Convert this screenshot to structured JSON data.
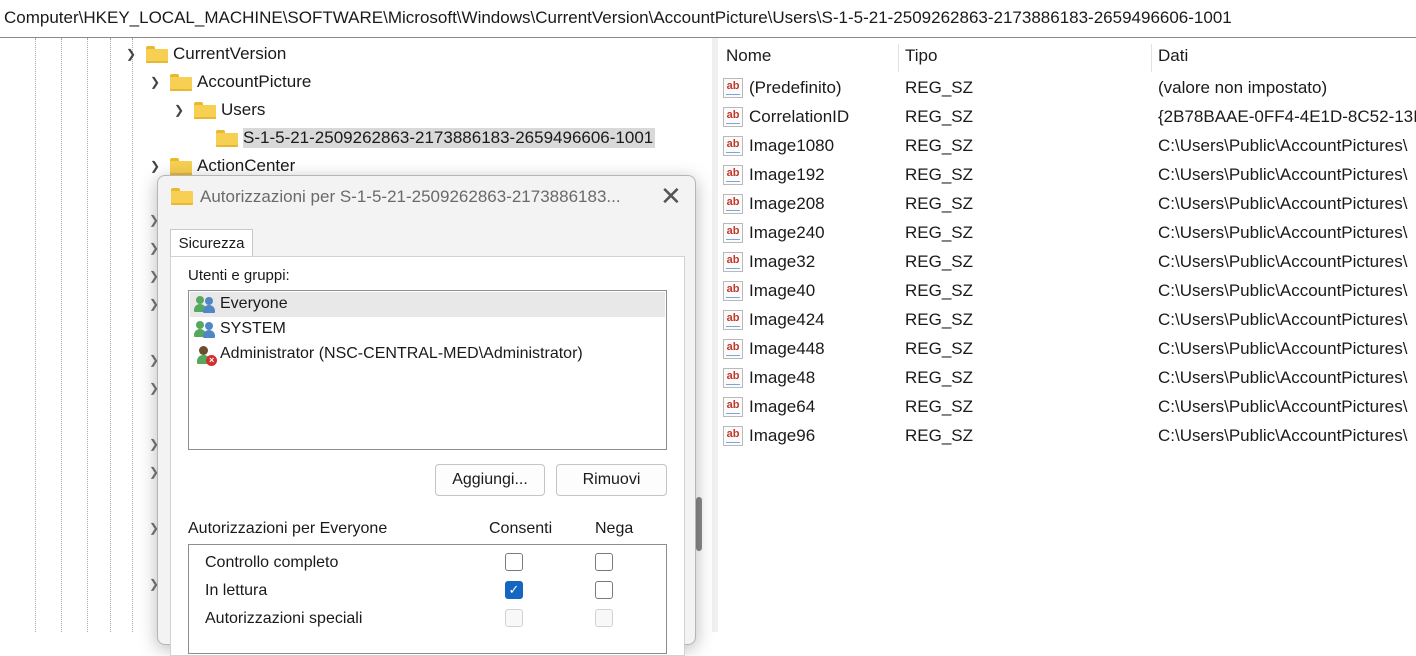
{
  "address_bar": {
    "path": "Computer\\HKEY_LOCAL_MACHINE\\SOFTWARE\\Microsoft\\Windows\\CurrentVersion\\AccountPicture\\Users\\S-1-5-21-2509262863-2173886183-2659496606-1001"
  },
  "tree": {
    "items": [
      {
        "label": "CurrentVersion",
        "expanded": true
      },
      {
        "label": "AccountPicture",
        "expanded": true
      },
      {
        "label": "Users",
        "expanded": true
      },
      {
        "label": "S-1-5-21-2509262863-2173886183-2659496606-1001",
        "selected": true
      },
      {
        "label": "ActionCenter",
        "expanded": false
      }
    ]
  },
  "values_list": {
    "columns": {
      "name": "Nome",
      "type": "Tipo",
      "data": "Dati"
    },
    "rows": [
      {
        "name": "(Predefinito)",
        "type": "REG_SZ",
        "data": "(valore non impostato)"
      },
      {
        "name": "CorrelationID",
        "type": "REG_SZ",
        "data": "{2B78BAAE-0FF4-4E1D-8C52-13I"
      },
      {
        "name": "Image1080",
        "type": "REG_SZ",
        "data": "C:\\Users\\Public\\AccountPictures\\"
      },
      {
        "name": "Image192",
        "type": "REG_SZ",
        "data": "C:\\Users\\Public\\AccountPictures\\"
      },
      {
        "name": "Image208",
        "type": "REG_SZ",
        "data": "C:\\Users\\Public\\AccountPictures\\"
      },
      {
        "name": "Image240",
        "type": "REG_SZ",
        "data": "C:\\Users\\Public\\AccountPictures\\"
      },
      {
        "name": "Image32",
        "type": "REG_SZ",
        "data": "C:\\Users\\Public\\AccountPictures\\"
      },
      {
        "name": "Image40",
        "type": "REG_SZ",
        "data": "C:\\Users\\Public\\AccountPictures\\"
      },
      {
        "name": "Image424",
        "type": "REG_SZ",
        "data": "C:\\Users\\Public\\AccountPictures\\"
      },
      {
        "name": "Image448",
        "type": "REG_SZ",
        "data": "C:\\Users\\Public\\AccountPictures\\"
      },
      {
        "name": "Image48",
        "type": "REG_SZ",
        "data": "C:\\Users\\Public\\AccountPictures\\"
      },
      {
        "name": "Image64",
        "type": "REG_SZ",
        "data": "C:\\Users\\Public\\AccountPictures\\"
      },
      {
        "name": "Image96",
        "type": "REG_SZ",
        "data": "C:\\Users\\Public\\AccountPictures\\"
      }
    ],
    "string_icon_text": "ab"
  },
  "dialog": {
    "title": "Autorizzazioni per S-1-5-21-2509262863-2173886183...",
    "close_glyph": "✕",
    "tab_label": "Sicurezza",
    "users_label": "Utenti e gruppi:",
    "users": [
      {
        "name": "Everyone",
        "icon": "group-icon",
        "selected": true
      },
      {
        "name": "SYSTEM",
        "icon": "group-icon"
      },
      {
        "name": "Administrator (NSC-CENTRAL-MED\\Administrator)",
        "icon": "user-denied-icon"
      }
    ],
    "add_button": "Aggiungi...",
    "remove_button": "Rimuovi",
    "permissions_label": "Autorizzazioni per Everyone",
    "allow_label": "Consenti",
    "deny_label": "Nega",
    "permissions": [
      {
        "name": "Controllo completo",
        "allow": false,
        "deny": false,
        "disabled": false
      },
      {
        "name": "In lettura",
        "allow": true,
        "deny": false,
        "disabled": false
      },
      {
        "name": "Autorizzazioni speciali",
        "allow": false,
        "deny": false,
        "disabled": true
      }
    ]
  },
  "colors": {
    "accent": "#1566c0",
    "folder": "#f7cf52",
    "selection": "#d9d9d9"
  }
}
